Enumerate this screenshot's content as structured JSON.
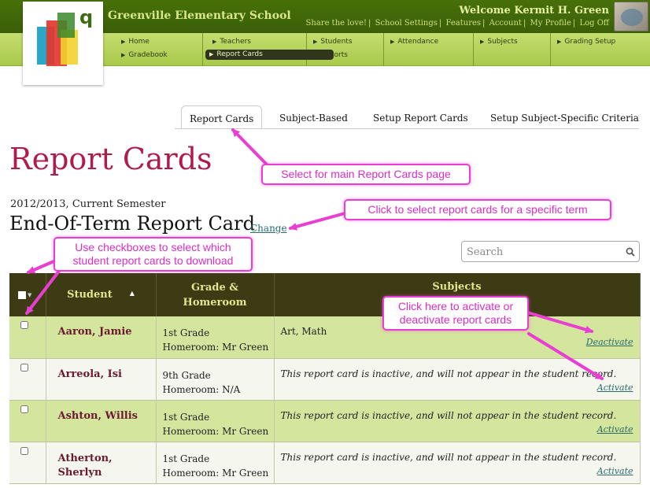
{
  "header": {
    "school_name": "Greenville Elementary School",
    "welcome": "Welcome Kermit H. Green",
    "links": [
      "Share the love!",
      "School Settings",
      "Features",
      "Account",
      "My Profile",
      "Log Off"
    ]
  },
  "nav": {
    "home": "Home",
    "gradebook": "Gradebook",
    "teachers": "Teachers",
    "report_cards": "Report Cards",
    "students": "Students",
    "reports": "Reports",
    "attendance": "Attendance",
    "subjects": "Subjects",
    "grading_setup": "Grading Setup"
  },
  "logo": {
    "letter": "q"
  },
  "tabs": [
    "Report Cards",
    "Subject-Based",
    "Setup Report Cards",
    "Setup Subject-Specific Criteria"
  ],
  "page": {
    "title": "Report Cards",
    "term": "2012/2013, Current Semester",
    "report_card_type": "End-Of-Term Report Card",
    "change_link": "Change"
  },
  "search": {
    "placeholder": "Search"
  },
  "table": {
    "headers": {
      "student": "Student",
      "grade_line1": "Grade &",
      "grade_line2": "Homeroom",
      "subjects": "Subjects"
    },
    "rows": [
      {
        "student": "Aaron, Jamie",
        "grade": "1st Grade",
        "homeroom": "Homeroom: Mr Green",
        "subjects": "Art, Math",
        "action": "Deactivate"
      },
      {
        "student": "Arreola, Isi",
        "grade": "9th Grade",
        "homeroom": "Homeroom: N/A",
        "subjects": "This report card is inactive, and will not appear in the student record.",
        "action": "Activate"
      },
      {
        "student": "Ashton, Willis",
        "grade": "1st Grade",
        "homeroom": "Homeroom: Mr Green",
        "subjects": "This report card is inactive, and will not appear in the student record.",
        "action": "Activate"
      },
      {
        "student": "Atherton,",
        "student2": "Sherlyn",
        "grade": "1st Grade",
        "homeroom": "Homeroom: Mr Green",
        "subjects": "This report card is inactive, and will not appear in the student record.",
        "action": "Activate"
      }
    ]
  },
  "callouts": {
    "main_page": "Select for main Report Cards page",
    "specific_term": "Click to select report cards for a specific term",
    "checkboxes_line1": "Use checkboxes to select which",
    "checkboxes_line2": "student report cards to download",
    "activate_line1": "Click here to activate or",
    "activate_line2": "deactivate report cards"
  },
  "colors": {
    "title": "#b01c4a",
    "callout": "#e83ed1",
    "header_dark": "#3d3b14",
    "row_green": "#d4e59e"
  }
}
